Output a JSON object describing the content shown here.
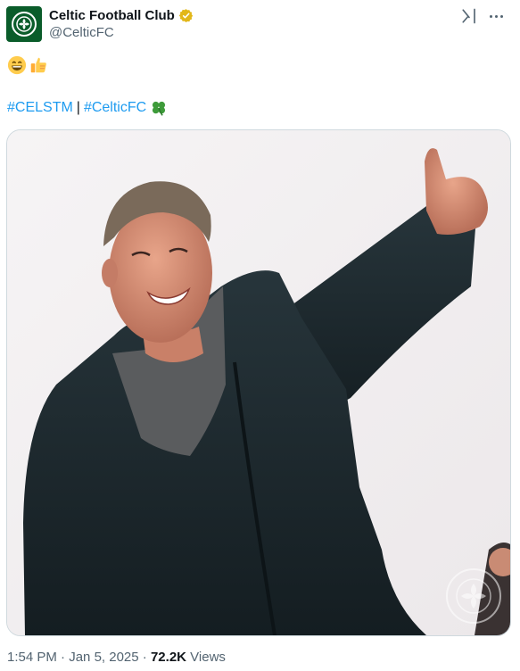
{
  "author": {
    "display_name": "Celtic Football Club",
    "handle": "@CelticFC",
    "verified": true
  },
  "tweet": {
    "emojis": [
      "grinning-face",
      "thumbs-up"
    ],
    "hashtags": [
      "#CELSTM",
      "#CelticFC"
    ],
    "separator": "|",
    "hashtag_emoji": "four-leaf-clover"
  },
  "meta": {
    "time": "1:54 PM",
    "dot1": "·",
    "date": "Jan 5, 2025",
    "dot2": "·",
    "views_count": "72.2K",
    "views_label": "Views"
  },
  "colors": {
    "link": "#1d9bf0",
    "secondary_text": "#536471",
    "celtic_green": "#0a5c2a",
    "verified_gold": "#e2b719"
  }
}
